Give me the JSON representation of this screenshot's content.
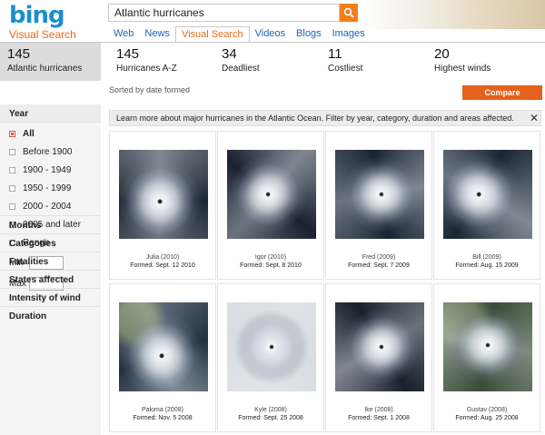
{
  "header": {
    "logo": "bing",
    "logo_sub": "Visual Search",
    "search_value": "Atlantic hurricanes",
    "nav": [
      {
        "label": "Web"
      },
      {
        "label": "News"
      },
      {
        "label": "Visual Search"
      },
      {
        "label": "Videos"
      },
      {
        "label": "Blogs"
      },
      {
        "label": "Images"
      }
    ]
  },
  "stats": [
    {
      "num": "145",
      "label": "Atlantic hurricanes"
    },
    {
      "num": "145",
      "label": "Hurricanes A-Z"
    },
    {
      "num": "34",
      "label": "Deadliest"
    },
    {
      "num": "11",
      "label": "Costliest"
    },
    {
      "num": "20",
      "label": "Highest winds"
    }
  ],
  "sidebar": {
    "year_title": "Year",
    "year_options": [
      {
        "label": "All"
      },
      {
        "label": "Before 1900"
      },
      {
        "label": "1900 - 1949"
      },
      {
        "label": "1950 - 1999"
      },
      {
        "label": "2000 - 2004"
      },
      {
        "label": "2005 and later"
      },
      {
        "label": "Range"
      }
    ],
    "min_label": "Min",
    "max_label": "Max",
    "sections": [
      {
        "label": "Months"
      },
      {
        "label": "Categories"
      },
      {
        "label": "Fatalities"
      },
      {
        "label": "States affected"
      },
      {
        "label": "Intensity of wind"
      },
      {
        "label": "Duration"
      }
    ]
  },
  "main": {
    "sorted": "Sorted by date formed",
    "compare_label": "Compare",
    "info_text": "Learn more about major hurricanes in the Atlantic Ocean. Filter by year, category, duration and areas affected.",
    "info_close": "✕"
  },
  "cards": [
    {
      "name": "Julia (2010)",
      "formed": "Formed: Sept. 12 2010"
    },
    {
      "name": "Igor (2010)",
      "formed": "Formed: Sept. 8 2010"
    },
    {
      "name": "Fred (2009)",
      "formed": "Formed: Sept. 7 2009"
    },
    {
      "name": "Bill (2009)",
      "formed": "Formed: Aug. 15 2009"
    },
    {
      "name": "Paloma (2008)",
      "formed": "Formed: Nov. 5 2008"
    },
    {
      "name": "Kyle (2008)",
      "formed": "Formed: Sept. 25 2008"
    },
    {
      "name": "Ike (2008)",
      "formed": "Formed: Sept. 1 2008"
    },
    {
      "name": "Gustav (2008)",
      "formed": "Formed: Aug. 25 2008"
    }
  ],
  "colors": {
    "brand_blue": "#1b8ed1",
    "accent_orange": "#e5611c"
  },
  "icons": {
    "search": "search-icon",
    "close": "close-icon",
    "radio_selected": "radio-selected-icon",
    "radio": "radio-icon"
  }
}
